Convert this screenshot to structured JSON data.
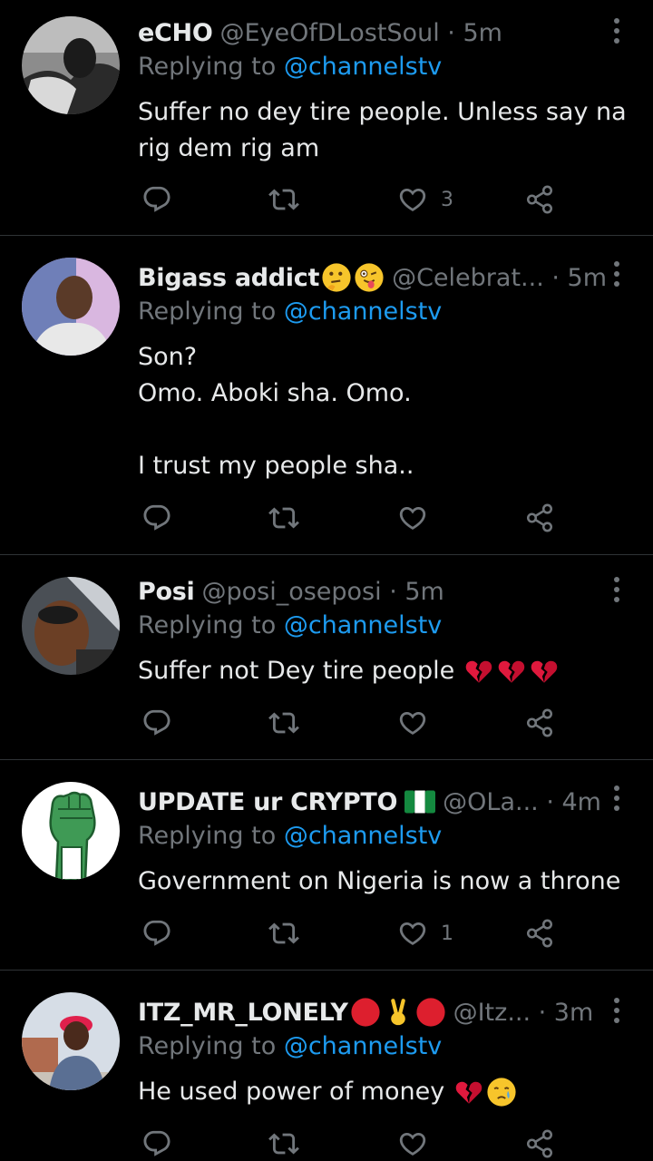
{
  "replying_label": "Replying to",
  "tweets": [
    {
      "name": "eCHO",
      "handle": "@EyeOfDLostSoul · 5m",
      "replying_to": "@channelstv",
      "body": "Suffer no dey tire people. Unless say na rig dem rig am",
      "like_count": "3",
      "avatar_icon": "avatar-photo-echo",
      "name_emojis": []
    },
    {
      "name": "Bigass addict",
      "handle": "@Celebrat... · 5m",
      "replying_to": "@channelstv",
      "body": "Son?\nOmo. Aboki sha. Omo.\n\nI trust my people sha..",
      "like_count": "",
      "avatar_icon": "avatar-photo-bigass",
      "name_emojis": [
        "thinking-face-emoji",
        "winking-tongue-emoji"
      ]
    },
    {
      "name": "Posi",
      "handle": "@posi_oseposi · 5m",
      "replying_to": "@channelstv",
      "body": "Suffer not Dey tire people",
      "body_emojis": [
        "broken-heart-emoji",
        "broken-heart-emoji",
        "broken-heart-emoji"
      ],
      "like_count": "",
      "avatar_icon": "avatar-photo-posi",
      "name_emojis": []
    },
    {
      "name": "UPDATE ur CRYPTO",
      "handle": "@OLa... · 4m",
      "replying_to": "@channelstv",
      "body": "Government on Nigeria is now a throne",
      "like_count": "1",
      "avatar_icon": "avatar-raised-fist",
      "name_emojis": [
        "nigeria-flag-emoji"
      ]
    },
    {
      "name": "ITZ_MR_LONELY",
      "handle": "@Itz... · 3m",
      "replying_to": "@channelstv",
      "body": "He used power of money",
      "body_emojis": [
        "broken-heart-emoji",
        "crying-face-emoji"
      ],
      "like_count": "",
      "avatar_icon": "avatar-photo-lonely",
      "name_emojis": [
        "red-circle-emoji",
        "victory-hand-emoji",
        "red-circle-emoji"
      ]
    }
  ],
  "colors": {
    "background": "#000000",
    "text": "#e7e9ea",
    "secondary": "#71767b",
    "link": "#1d9bf0",
    "divider": "#2f3336"
  }
}
